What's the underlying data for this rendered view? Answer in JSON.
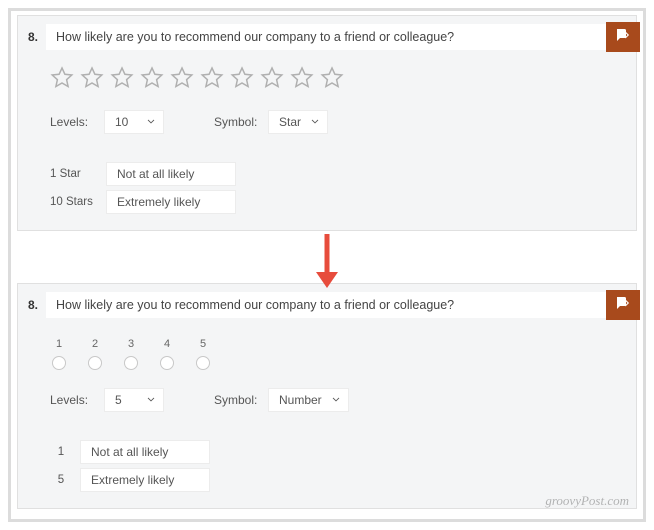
{
  "watermark": "groovyPost.com",
  "top": {
    "number": "8.",
    "question": "How likely are you to recommend our company to a friend or colleague?",
    "star_count": 10,
    "levels_label": "Levels:",
    "levels_value": "10",
    "symbol_label": "Symbol:",
    "symbol_value": "Star",
    "low_key": "1 Star",
    "low_value": "Not at all likely",
    "high_key": "10 Stars",
    "high_value": "Extremely likely"
  },
  "bottom": {
    "number": "8.",
    "question": "How likely are you to recommend our company to a friend or colleague?",
    "numbers": [
      "1",
      "2",
      "3",
      "4",
      "5"
    ],
    "levels_label": "Levels:",
    "levels_value": "5",
    "symbol_label": "Symbol:",
    "symbol_value": "Number",
    "low_key": "1",
    "low_value": "Not at all likely",
    "high_key": "5",
    "high_value": "Extremely likely"
  }
}
